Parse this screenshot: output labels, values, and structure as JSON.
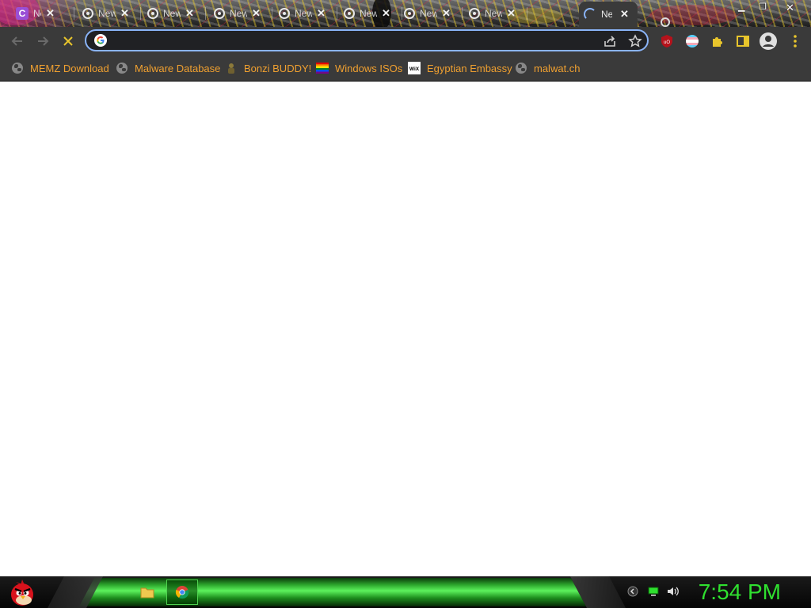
{
  "tabs": [
    {
      "title": "New Tab"
    },
    {
      "title": "New Tab"
    },
    {
      "title": "New Tab"
    },
    {
      "title": "New Tab"
    },
    {
      "title": "New Tab"
    },
    {
      "title": "New Tab"
    },
    {
      "title": "New Tab"
    },
    {
      "title": "New Tab"
    }
  ],
  "active_tab": {
    "title": "New Tab",
    "state": "loading"
  },
  "omnibox": {
    "value": "",
    "placeholder": ""
  },
  "bookmarks": [
    {
      "label": "MEMZ Download",
      "icon": "globe-icon"
    },
    {
      "label": "Malware Database",
      "icon": "globe-icon"
    },
    {
      "label": "Bonzi BUDDY!",
      "icon": "bonzi-buddy-icon"
    },
    {
      "label": "Windows ISOs",
      "icon": "rainbow-flag-icon"
    },
    {
      "label": "Egyptian Embassy",
      "icon": "wix-icon"
    },
    {
      "label": "malwat.ch",
      "icon": "globe-icon"
    }
  ],
  "taskbar": {
    "clock": "7:54 PM"
  },
  "colors": {
    "chrome_dark": "#3a3a3a",
    "omnibox_focus": "#8ab4f8",
    "bookmark_text": "#f0a030",
    "taskbar_green": "#2fe02f",
    "stop_button": "#e8c52c"
  }
}
